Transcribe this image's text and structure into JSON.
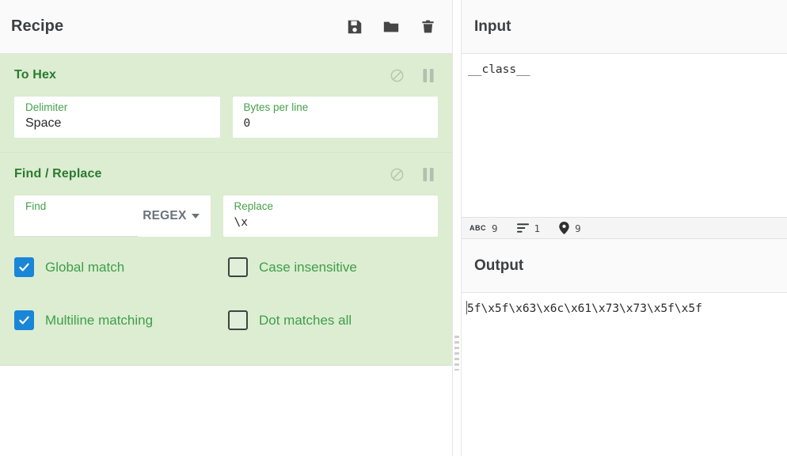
{
  "theme": {
    "operation_bg": "#dcedd2",
    "accent_green": "#2b7a2f",
    "label_green": "#47a04b",
    "checkbox_blue": "#1a86d8",
    "header_bg": "#fafafa"
  },
  "recipe": {
    "title": "Recipe",
    "controls": [
      {
        "name": "save-recipe-button",
        "icon": "save-icon"
      },
      {
        "name": "load-recipe-button",
        "icon": "folder-icon"
      },
      {
        "name": "clear-recipe-button",
        "icon": "trash-icon"
      }
    ],
    "operations": [
      {
        "name": "To Hex",
        "disable_icon": "ban-icon",
        "breakpoint_icon": "pause-icon",
        "args": [
          {
            "label": "Delimiter",
            "value": "Space",
            "type": "select"
          },
          {
            "label": "Bytes per line",
            "value": "0",
            "type": "number"
          }
        ]
      },
      {
        "name": "Find / Replace",
        "disable_icon": "ban-icon",
        "breakpoint_icon": "pause-icon",
        "args": [
          {
            "label": "Find",
            "value": "",
            "type": "text-with-mode",
            "mode": "REGEX"
          },
          {
            "label": "Replace",
            "value": "\\x",
            "type": "text"
          }
        ],
        "checkboxes": [
          {
            "label": "Global match",
            "checked": true
          },
          {
            "label": "Case insensitive",
            "checked": false
          },
          {
            "label": "Multiline matching",
            "checked": true
          },
          {
            "label": "Dot matches all",
            "checked": false
          }
        ]
      }
    ]
  },
  "input": {
    "title": "Input",
    "value": "__class__",
    "status": {
      "length_icon": "abc-icon",
      "length_label": "ABC",
      "length": "9",
      "lines_icon": "lines-icon",
      "lines": "1",
      "position_icon": "map-pin-icon",
      "position": "9"
    }
  },
  "output": {
    "title": "Output",
    "value": "5f\\x5f\\x63\\x6c\\x61\\x73\\x73\\x5f\\x5f"
  }
}
